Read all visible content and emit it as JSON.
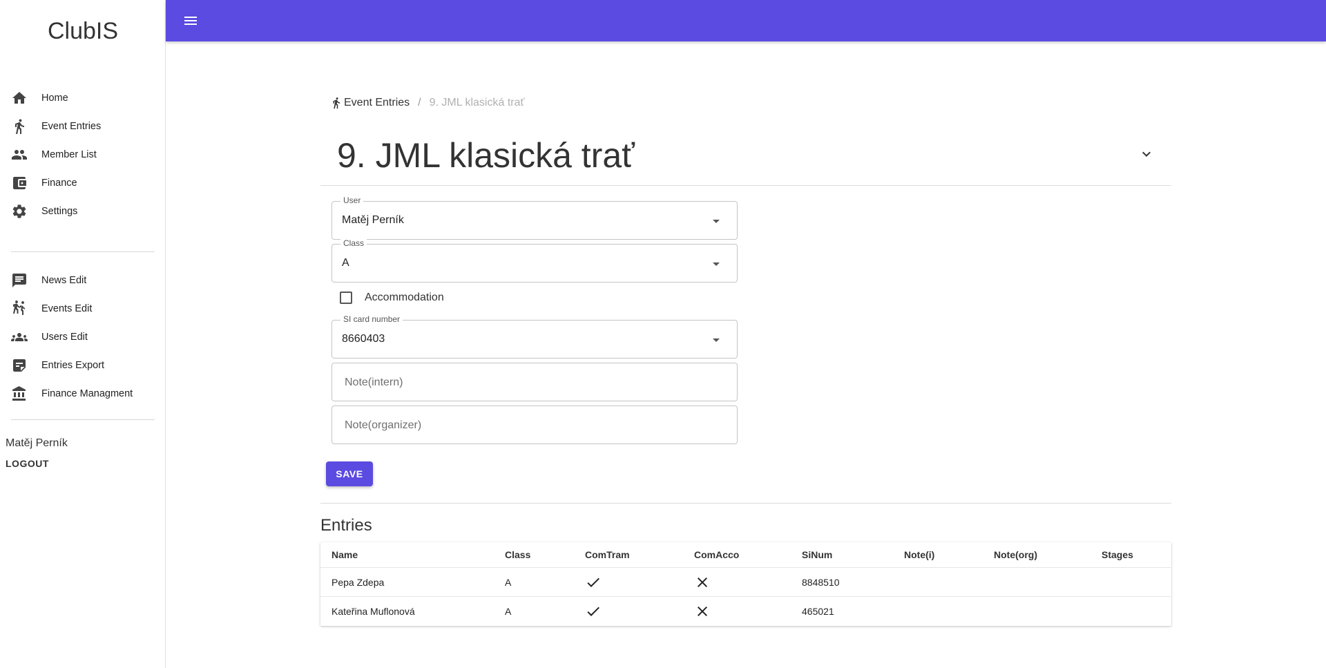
{
  "app": {
    "brand": "ClubIS"
  },
  "colors": {
    "primary": "#5b4be1",
    "sidebar_bg": "#ffffff"
  },
  "sidebar": {
    "primary_items": [
      {
        "label": "Home",
        "icon": "home-icon"
      },
      {
        "label": "Event Entries",
        "icon": "runner-icon"
      },
      {
        "label": "Member List",
        "icon": "people-icon"
      },
      {
        "label": "Finance",
        "icon": "wallet-icon"
      },
      {
        "label": "Settings",
        "icon": "gear-icon"
      }
    ],
    "admin_items": [
      {
        "label": "News Edit",
        "icon": "chat-icon"
      },
      {
        "label": "Events Edit",
        "icon": "group-runners-icon"
      },
      {
        "label": "Users Edit",
        "icon": "groups-icon"
      },
      {
        "label": "Entries Export",
        "icon": "note-icon"
      },
      {
        "label": "Finance Managment",
        "icon": "bank-icon"
      }
    ],
    "user_name": "Matěj Perník",
    "logout_label": "LOGOUT"
  },
  "topbar": {
    "menu_icon": "hamburger-menu-icon"
  },
  "breadcrumb": {
    "link_label": "Event Entries",
    "separator": "/",
    "current": "9. JML klasická trať"
  },
  "page_title": "9. JML klasická trať",
  "form": {
    "user": {
      "label": "User",
      "value": "Matěj Perník"
    },
    "class": {
      "label": "Class",
      "value": "A"
    },
    "accommodation": {
      "label": "Accommodation",
      "checked": false
    },
    "si_card": {
      "label": "SI card number",
      "value": "8660403"
    },
    "note_intern": {
      "placeholder": "Note(intern)"
    },
    "note_organizer": {
      "placeholder": "Note(organizer)"
    },
    "save_label": "SAVE"
  },
  "entries": {
    "title": "Entries",
    "columns": [
      "Name",
      "Class",
      "ComTram",
      "ComAcco",
      "SiNum",
      "Note(i)",
      "Note(org)",
      "Stages"
    ],
    "rows": [
      {
        "name": "Pepa Zdepa",
        "class": "A",
        "comtram": true,
        "comacco": false,
        "sinum": "8848510",
        "note_i": "",
        "note_org": "",
        "stages": ""
      },
      {
        "name": "Kateřina Muflonová",
        "class": "A",
        "comtram": true,
        "comacco": false,
        "sinum": "465021",
        "note_i": "",
        "note_org": "",
        "stages": ""
      }
    ]
  }
}
